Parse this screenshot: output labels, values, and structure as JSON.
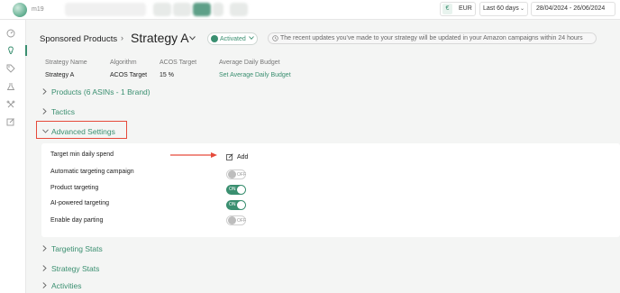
{
  "topbar": {
    "brand": "m19",
    "currency_symbol": "€",
    "currency": "EUR",
    "date_range": "Last 60 days",
    "dates": "28/04/2024 - 26/06/2024"
  },
  "sidebar": {
    "icons": [
      "dashboard-icon",
      "lightbulb-icon",
      "tag-icon",
      "flask-icon",
      "tools-icon",
      "edit-icon"
    ]
  },
  "header": {
    "breadcrumb": "Sponsored Products",
    "separator": "›",
    "title": "Strategy A",
    "status": "Activated",
    "notice": "The recent updates you've made to your strategy will be updated in your Amazon campaigns within 24 hours"
  },
  "info": {
    "name_label": "Strategy Name",
    "name_value": "Strategy A",
    "algorithm_label": "Algorithm",
    "algorithm_value": "ACOS Target",
    "acos_label": "ACOS Target",
    "acos_value": "15 %",
    "budget_label": "Average Daily Budget",
    "budget_link": "Set Average Daily Budget"
  },
  "sections": {
    "products": "Products (6 ASINs - 1 Brand)",
    "tactics": "Tactics",
    "advanced": "Advanced Settings",
    "targeting_stats": "Targeting Stats",
    "strategy_stats": "Strategy Stats",
    "activities": "Activities"
  },
  "advanced": {
    "min_spend_label": "Target min daily spend",
    "add_label": "Add",
    "auto_label": "Automatic targeting campaign",
    "auto_state": "OFF",
    "product_label": "Product targeting",
    "product_state": "ON",
    "ai_label": "AI-powered targeting",
    "ai_state": "ON",
    "dayparting_label": "Enable day parting",
    "dayparting_state": "OFF"
  },
  "colors": {
    "accent": "#3a8f70",
    "highlight": "#e64a3b"
  }
}
